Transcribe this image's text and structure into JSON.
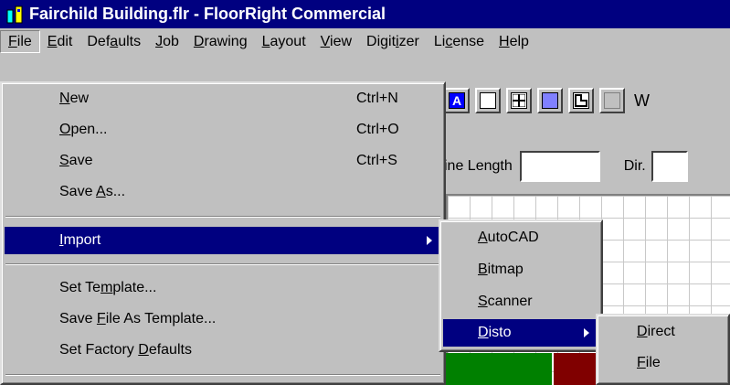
{
  "window": {
    "title": "Fairchild Building.flr - FloorRight Commercial"
  },
  "menubar": [
    {
      "key": "file",
      "pre": "",
      "mn": "F",
      "post": "ile"
    },
    {
      "key": "edit",
      "pre": "",
      "mn": "E",
      "post": "dit"
    },
    {
      "key": "defaults",
      "pre": "Def",
      "mn": "a",
      "post": "ults"
    },
    {
      "key": "job",
      "pre": "",
      "mn": "J",
      "post": "ob"
    },
    {
      "key": "drawing",
      "pre": "",
      "mn": "D",
      "post": "rawing"
    },
    {
      "key": "layout",
      "pre": "",
      "mn": "L",
      "post": "ayout"
    },
    {
      "key": "view",
      "pre": "",
      "mn": "V",
      "post": "iew"
    },
    {
      "key": "digitizer",
      "pre": "Digit",
      "mn": "i",
      "post": "zer"
    },
    {
      "key": "license",
      "pre": "Li",
      "mn": "c",
      "post": "ense"
    },
    {
      "key": "help",
      "pre": "",
      "mn": "H",
      "post": "elp"
    }
  ],
  "file_menu": {
    "new": {
      "pre": "",
      "mn": "N",
      "post": "ew",
      "shortcut": "Ctrl+N"
    },
    "open": {
      "pre": "",
      "mn": "O",
      "post": "pen...",
      "shortcut": "Ctrl+O"
    },
    "save": {
      "pre": "",
      "mn": "S",
      "post": "ave",
      "shortcut": "Ctrl+S"
    },
    "save_as": {
      "pre": "Save ",
      "mn": "A",
      "post": "s..."
    },
    "import": {
      "pre": "",
      "mn": "I",
      "post": "mport"
    },
    "set_template": {
      "pre": "Set Te",
      "mn": "m",
      "post": "plate..."
    },
    "save_file_as_template": {
      "pre": "Save ",
      "mn": "F",
      "post": "ile As Template..."
    },
    "set_factory_defaults": {
      "pre": "Set Factory ",
      "mn": "D",
      "post": "efaults"
    }
  },
  "import_menu": {
    "autocad": {
      "pre": "",
      "mn": "A",
      "post": "utoCAD"
    },
    "bitmap": {
      "pre": "",
      "mn": "B",
      "post": "itmap"
    },
    "scanner": {
      "pre": "",
      "mn": "S",
      "post": "canner"
    },
    "disto": {
      "pre": "",
      "mn": "D",
      "post": "isto"
    }
  },
  "disto_menu": {
    "direct": {
      "pre": "",
      "mn": "D",
      "post": "irect"
    },
    "file": {
      "pre": "",
      "mn": "F",
      "post": "ile"
    }
  },
  "toolbar": {
    "button_a": "A",
    "trailing_label": "W"
  },
  "linebar": {
    "line_length_label": "ine Length",
    "dir_label": "Dir."
  },
  "colors": {
    "titlebar": "#000080",
    "highlight": "#000080",
    "face": "#c0c0c0",
    "green_block": "#008000",
    "red_block": "#800000"
  }
}
